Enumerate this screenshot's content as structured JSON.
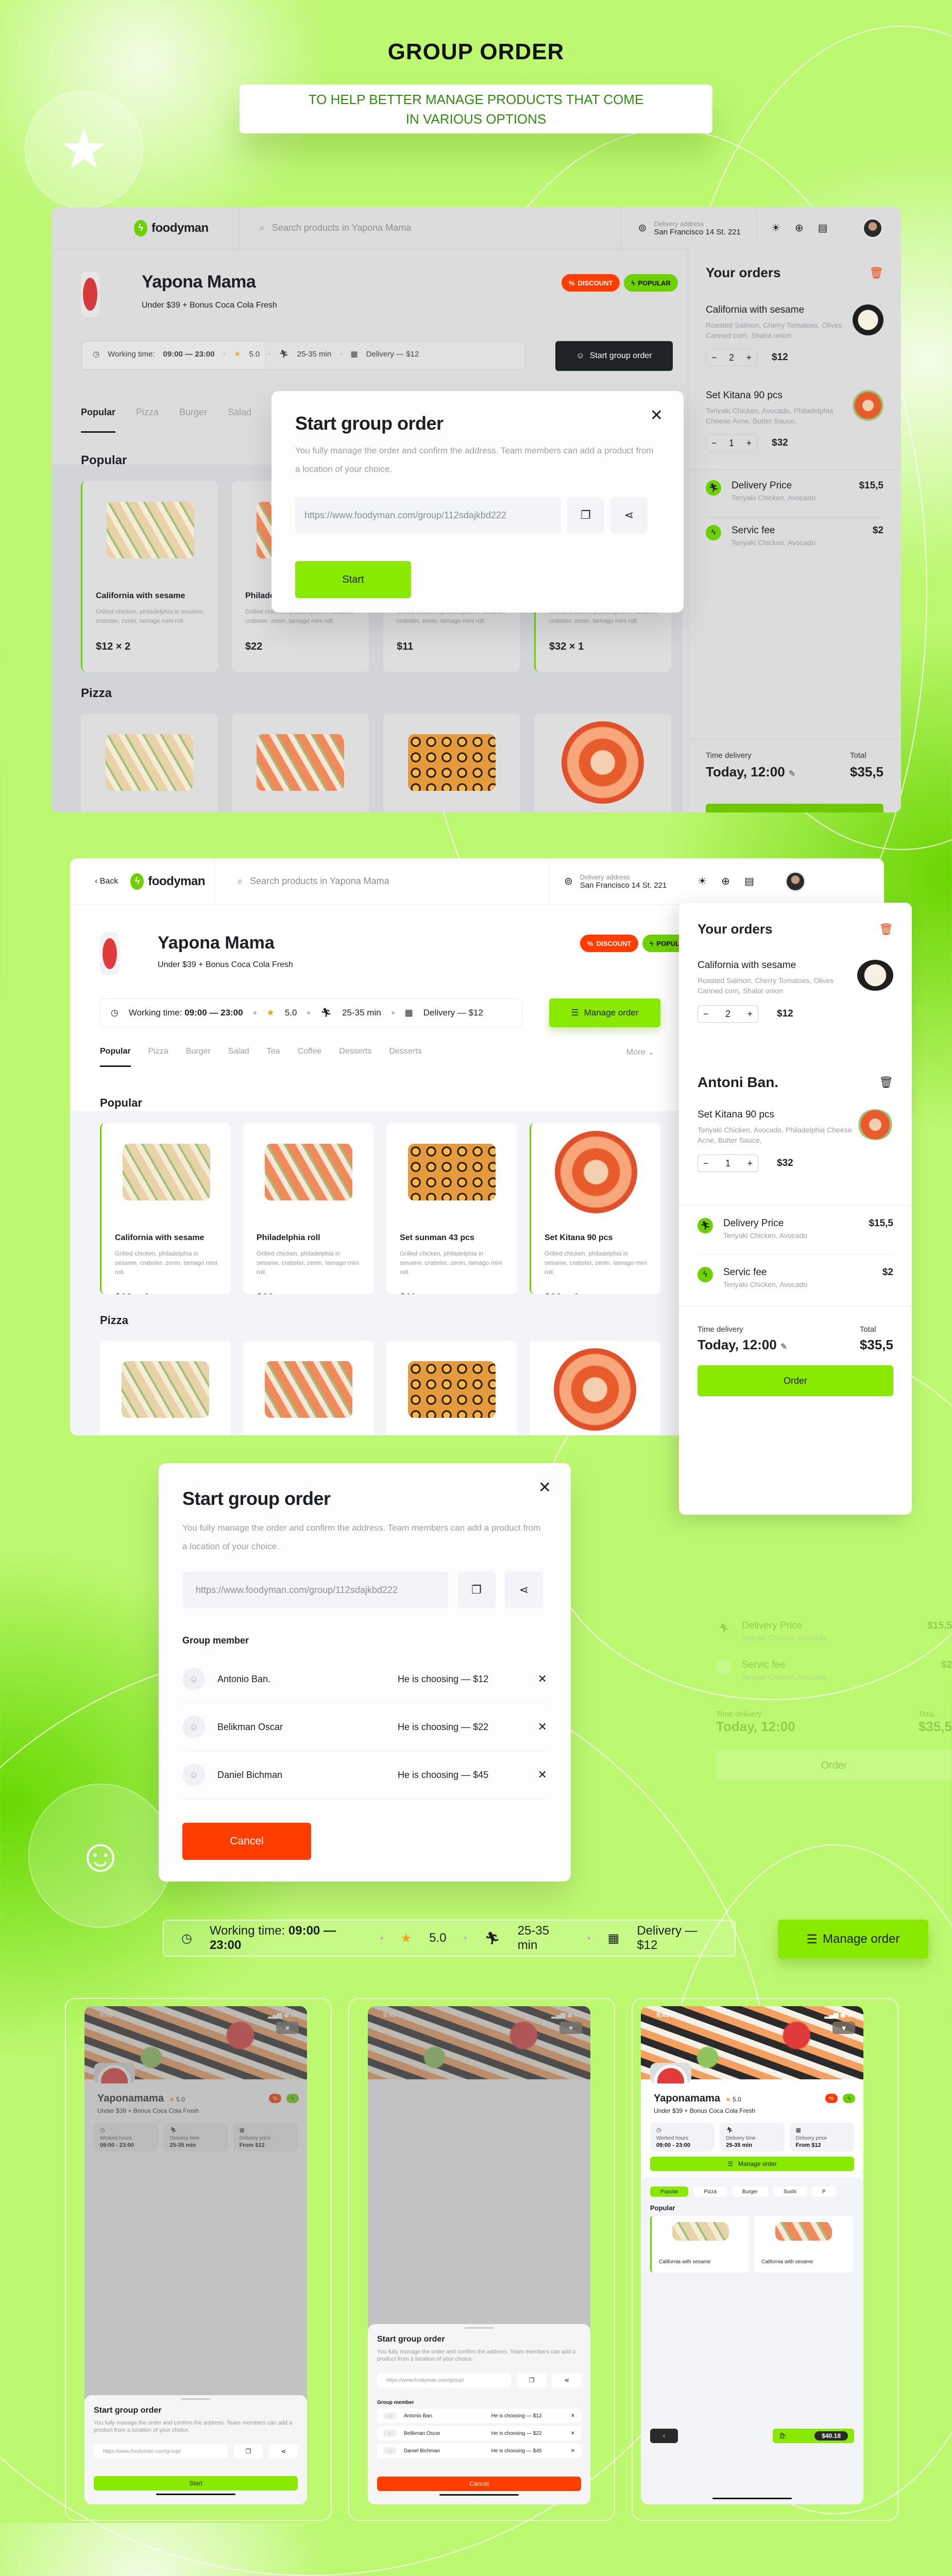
{
  "hero": {
    "title": "GROUP ORDER",
    "subtitle": "TO HELP BETTER MANAGE PRODUCTS THAT COME IN VARIOUS OPTIONS"
  },
  "colors": {
    "accent": "#89ea00",
    "accent_dark": "#6dd100",
    "danger": "#ff3d00",
    "dark": "#1c2024"
  },
  "header": {
    "back_label": "Back",
    "logo": "foodyman",
    "search_placeholder": "Search products in Yapona Mama",
    "delivery_label": "Delivery address",
    "delivery_address": "San Francisco 14 St. 221"
  },
  "restaurant": {
    "name": "Yapona Mama",
    "mobile_name": "Yaponamama",
    "subtitle": "Under $39 + Bonus Coca Cola Fresh",
    "badge_discount": "DISCOUNT",
    "badge_popular": "POPULAR",
    "working_label": "Working time:",
    "working_hours": "09:00 — 23:00",
    "rating": "5.0",
    "delivery_time": "25-35 min",
    "delivery_fee": "Delivery — $12",
    "start_group_order": "Start group order",
    "manage_order": "Manage order"
  },
  "tabs": [
    "Popular",
    "Pizza",
    "Burger",
    "Salad",
    "Tea",
    "Coffee",
    "Desserts",
    "Desserts"
  ],
  "more_label": "More",
  "sections": {
    "popular": "Popular",
    "pizza": "Pizza"
  },
  "products": [
    {
      "name": "California with sesame",
      "desc": "Grilled chicken, philadelphia in sesame, crabster, zenin, tamago mini roll.",
      "price": "$12 × 2",
      "selected": true
    },
    {
      "name": "Philadelphia roll",
      "desc": "Grilled chicken, philadelphia in sesame, crabster, zenin, tamago mini roll.",
      "price": "$22",
      "selected": false
    },
    {
      "name": "Set sunman 43 pcs",
      "desc": "Grilled chicken, philadelphia in sesame, crabster, zenin, tamago mini roll.",
      "price": "$11",
      "selected": false
    },
    {
      "name": "Set Kitana 90 pcs",
      "desc": "Grilled chicken, philadelphia in sesame, crabster, zenin, tamago mini roll.",
      "price": "$32 × 1",
      "selected": true
    }
  ],
  "orders": {
    "title": "Your orders",
    "member_title": "Antoni Ban.",
    "items": [
      {
        "name": "California with sesame",
        "desc": "Roasted Salmon, Cherry Tomatoes, Olives Canned corn, Shalot onion",
        "qty": "2",
        "price": "$12"
      },
      {
        "name": "Set Kitana 90 pcs",
        "desc": "Teriyaki Chicken, Avocado, Philadelphia Cheese Acne, Butter Sauce,",
        "qty": "1",
        "price": "$32"
      }
    ],
    "fees": [
      {
        "name": "Delivery Price",
        "sub": "Teriyaki Chicken, Avocado",
        "price": "$15,5"
      },
      {
        "name": "Servic fee",
        "sub": "Teriyaki Chicken, Avocado",
        "price": "$2"
      }
    ],
    "time_label": "Time delivery",
    "time_value": "Today, 12:00",
    "total_label": "Total",
    "total_value": "$35,5",
    "order_button": "Order"
  },
  "modal": {
    "title": "Start group order",
    "desc": "You fully manage the order and confirm the address. Team members can add a product from a location of your choice.",
    "link": "https://www.foodyman.com/group/112sdajkbd222",
    "start_button": "Start",
    "cancel_button": "Cancel",
    "members_title": "Group member",
    "members": [
      {
        "name": "Antonio Ban.",
        "status": "He is choosing — $12"
      },
      {
        "name": "Belikman Oscar",
        "status": "He is choosing — $22"
      },
      {
        "name": "Daniel Bichman",
        "status": "He is choosing — $45"
      }
    ]
  },
  "mobile": {
    "time": "9:41",
    "stats": [
      {
        "label": "Worked hours",
        "value": "09:00 - 23:00"
      },
      {
        "label": "Delivery time",
        "value": "25-35 min"
      },
      {
        "label": "Delivery price",
        "value": "From $12"
      }
    ],
    "chips": [
      "Popular",
      "Pizza",
      "Burger",
      "Sushi",
      "P"
    ],
    "cart_total": "$40.18",
    "link_short": "https://www.foodyman.com/group/"
  }
}
